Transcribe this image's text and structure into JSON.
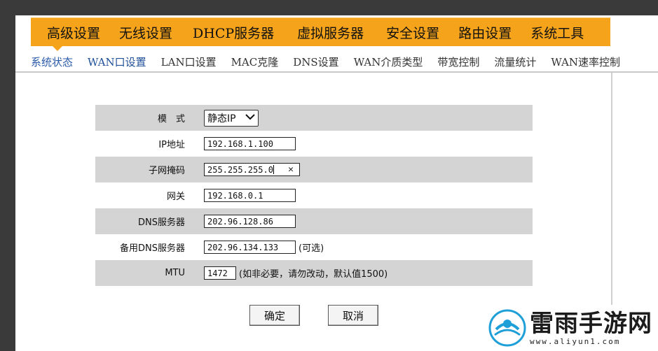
{
  "main_menu": [
    "高级设置",
    "无线设置",
    "DHCP服务器",
    "虚拟服务器",
    "安全设置",
    "路由设置",
    "系统工具"
  ],
  "sub_menu": [
    "系统状态",
    "WAN口设置",
    "LAN口设置",
    "MAC克隆",
    "DNS设置",
    "WAN介质类型",
    "带宽控制",
    "流量统计",
    "WAN速率控制"
  ],
  "form": {
    "mode_label": "模　式",
    "mode_value": "静态IP",
    "ip_label": "IP地址",
    "ip_value": "192.168.1.100",
    "mask_label": "子网掩码",
    "mask_value": "255.255.255.0",
    "gateway_label": "网关",
    "gateway_value": "192.168.0.1",
    "dns_label": "DNS服务器",
    "dns_value": "202.96.128.86",
    "dns2_label": "备用DNS服务器",
    "dns2_value": "202.96.134.133",
    "dns2_hint": "(可选)",
    "mtu_label": "MTU",
    "mtu_value": "1472",
    "mtu_hint": "(如非必要，请勿改动，默认值1500)"
  },
  "buttons": {
    "ok": "确定",
    "cancel": "取消"
  },
  "watermark": {
    "title": "雷雨手游网",
    "url": "www.aliyun1.com"
  },
  "colors": {
    "menu_orange": "#f5a31a",
    "row_gray": "#d4d4d4",
    "active_blue": "#1f4f9a"
  }
}
